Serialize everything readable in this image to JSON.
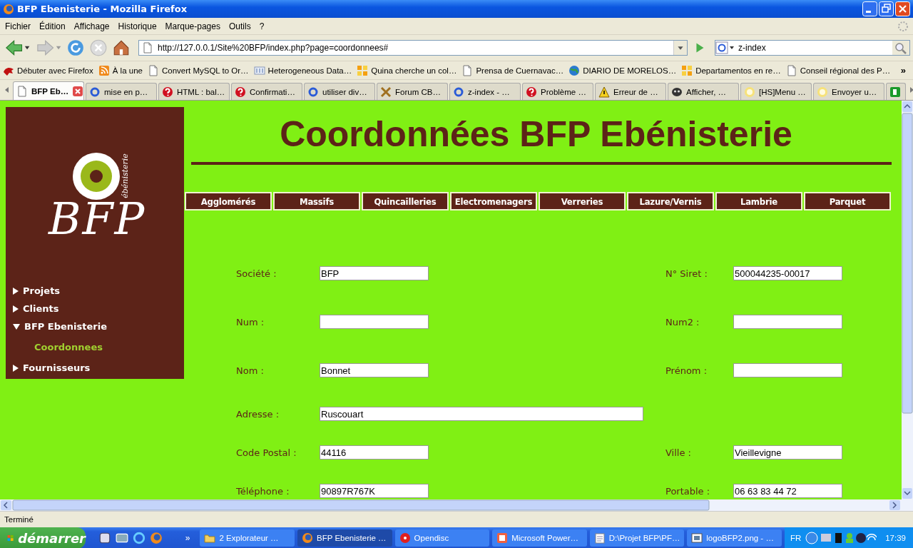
{
  "window": {
    "title": "BFP Ebenisterie - Mozilla Firefox"
  },
  "menu_bar": [
    "Fichier",
    "Édition",
    "Affichage",
    "Historique",
    "Marque-pages",
    "Outils",
    "?"
  ],
  "toolbar": {
    "url": "http://127.0.0.1/Site%20BFP/index.php?page=coordonnees#",
    "search": "z-index"
  },
  "bookmarks": [
    {
      "label": "Débuter avec Firefox",
      "kind": "fox"
    },
    {
      "label": "À la une",
      "kind": "rss"
    },
    {
      "label": "Convert MySQL to Or…",
      "kind": "page"
    },
    {
      "label": "Heterogeneous Data…",
      "kind": "bc"
    },
    {
      "label": "Quina cherche un col…",
      "kind": "er"
    },
    {
      "label": "Prensa de Cuernavac…",
      "kind": "page"
    },
    {
      "label": "DIARIO DE MORELOS…",
      "kind": "globe"
    },
    {
      "label": "Departamentos en re…",
      "kind": "er"
    },
    {
      "label": "Conseil régional des P…",
      "kind": "page"
    }
  ],
  "bookmarks_more": "»",
  "tabs": [
    {
      "label": "BFP Eb…",
      "kind": "page",
      "selected": true
    },
    {
      "label": "mise en p…",
      "kind": "google",
      "selected": false
    },
    {
      "label": "HTML : bal…",
      "kind": "help",
      "selected": false
    },
    {
      "label": "Confirmati…",
      "kind": "help",
      "selected": false
    },
    {
      "label": "utiliser div…",
      "kind": "google",
      "selected": false
    },
    {
      "label": "Forum CB…",
      "kind": "tools",
      "selected": false
    },
    {
      "label": "z-index - …",
      "kind": "google",
      "selected": false
    },
    {
      "label": "Problème …",
      "kind": "help",
      "selected": false
    },
    {
      "label": "Erreur de …",
      "kind": "warning",
      "selected": false
    },
    {
      "label": "Afficher, …",
      "kind": "mask",
      "selected": false
    },
    {
      "label": "[HS]Menu …",
      "kind": "sun",
      "selected": false
    },
    {
      "label": "Envoyer u…",
      "kind": "sun",
      "selected": false
    },
    {
      "kind": "d",
      "selected": false
    }
  ],
  "page": {
    "logo": {
      "text": "BFP",
      "tagline": "ébénisterie"
    },
    "sidebar": {
      "items": [
        {
          "label": "Projets",
          "expanded": false
        },
        {
          "label": "Clients",
          "expanded": false
        },
        {
          "label": "BFP Ebenisterie",
          "expanded": true,
          "children": [
            {
              "label": "Coordonnees",
              "selected": true
            }
          ]
        },
        {
          "label": "Fournisseurs",
          "expanded": false
        }
      ]
    },
    "heading": "Coordonnées BFP Ebénisterie",
    "nav": [
      "Agglomérés",
      "Massifs",
      "Quincailleries",
      "Electromenagers",
      "Verreries",
      "Lazure/Vernis",
      "Lambrie",
      "Parquet"
    ],
    "form": {
      "rows": [
        {
          "left": {
            "label": "Société :",
            "value": "BFP"
          },
          "right": {
            "label": "N° Siret :",
            "value": "500044235-00017"
          }
        },
        {
          "left": {
            "label": "Num :"
          },
          "right": {
            "label": "Num2 :"
          }
        },
        {
          "left": {
            "label": "Nom :",
            "value": "Bonnet"
          },
          "right": {
            "label": "Prénom :"
          }
        },
        {
          "left": {
            "label": "Adresse :",
            "value": "Ruscouart",
            "wide": true
          }
        },
        {
          "left": {
            "label": "Code Postal :",
            "value": "44116"
          },
          "right": {
            "label": "Ville :",
            "value": "Vieillevigne"
          }
        },
        {
          "left": {
            "label": "Téléphone :",
            "value": "90897R767K"
          },
          "right": {
            "label": "Portable :",
            "value": "06 63 83 44 72"
          }
        }
      ]
    }
  },
  "status_bar": "Terminé",
  "taskbar": {
    "start": "démarrer",
    "quick_more": "»",
    "tasks": [
      {
        "label": "2 Explorateur …",
        "kind": "folder",
        "selected": false
      },
      {
        "label": "BFP Ebenisterie …",
        "kind": "firefox",
        "selected": true
      },
      {
        "label": "Opendisc",
        "kind": "disc",
        "selected": false
      },
      {
        "label": "Microsoft Power…",
        "kind": "power",
        "selected": false
      },
      {
        "label": "D:\\Projet BFP\\PF…",
        "kind": "notepad",
        "selected": false
      },
      {
        "label": "logoBFP2.png - …",
        "kind": "image",
        "selected": false
      }
    ],
    "language": "FR",
    "clock": "17:39"
  }
}
